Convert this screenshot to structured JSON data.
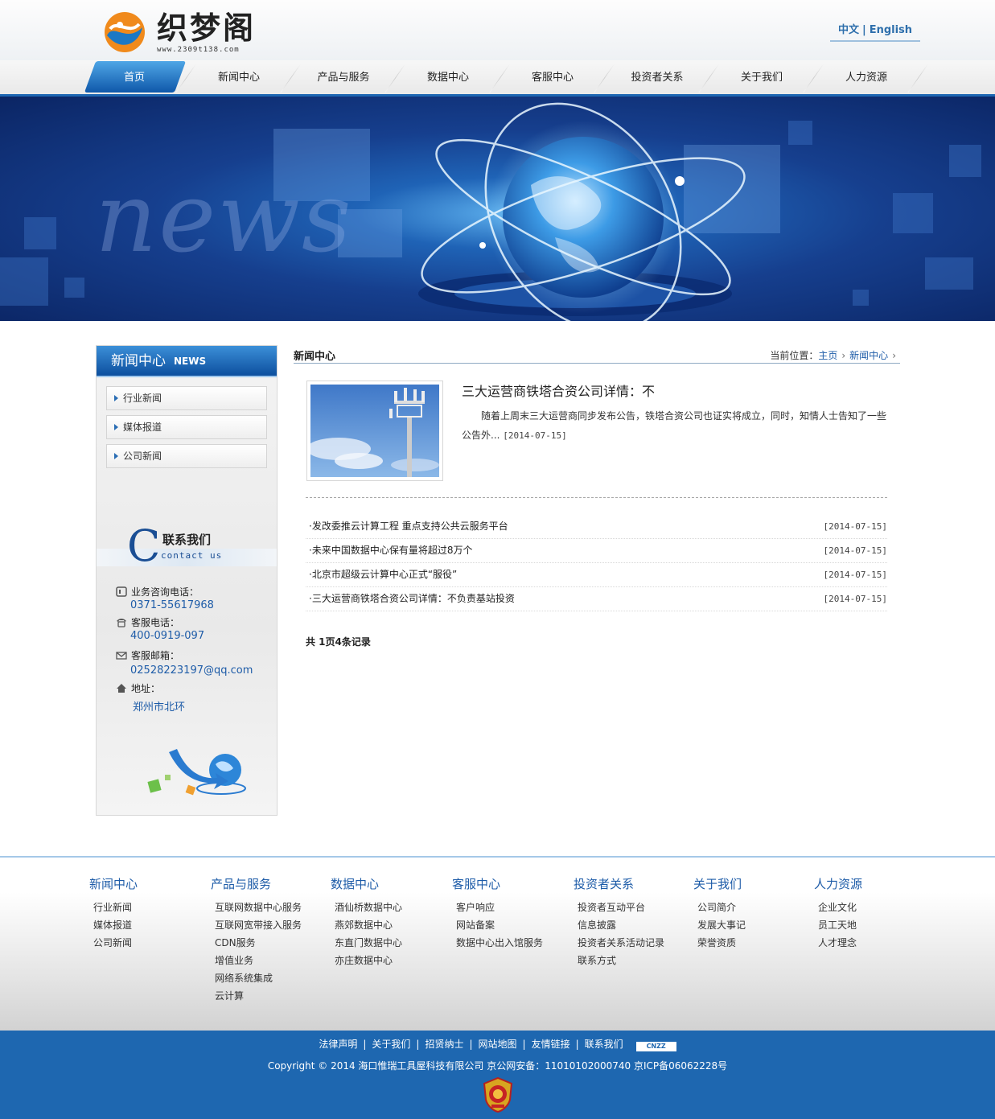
{
  "header": {
    "logo_text": "织梦阁",
    "logo_url": "www.2309t138.com",
    "lang_cn": "中文",
    "lang_en": "English"
  },
  "nav": {
    "items": [
      {
        "label": "首页",
        "active": true
      },
      {
        "label": "新闻中心"
      },
      {
        "label": "产品与服务"
      },
      {
        "label": "数据中心"
      },
      {
        "label": "客服中心"
      },
      {
        "label": "投资者关系"
      },
      {
        "label": "关于我们"
      },
      {
        "label": "人力资源"
      }
    ]
  },
  "banner": {
    "word": "news"
  },
  "sidebar": {
    "title_cn": "新闻中心",
    "title_en": "NEWS",
    "menu": [
      "行业新闻",
      "媒体报道",
      "公司新闻"
    ],
    "contact_cn": "联系我们",
    "contact_en": "contact us",
    "phone_label": "业务咨询电话：",
    "phone_value": "0371-55617968",
    "service_label": "客服电话：",
    "service_value": "400-0919-097",
    "email_label": "客服邮箱：",
    "email_value": "02528223197@qq.com",
    "addr_label": "地址：",
    "addr_value": "郑州市北环"
  },
  "main": {
    "title": "新闻中心",
    "crumb_label": "当前位置：",
    "crumb_home": "主页",
    "crumb_current": "新闻中心",
    "feature": {
      "title": "三大运营商铁塔合资公司详情：不",
      "desc": "随着上周末三大运营商同步发布公告，铁塔合资公司也证实将成立，同时，知情人士告知了一些公告外...",
      "date": "[2014-07-15]"
    },
    "list": [
      {
        "title": "·发改委推云计算工程 重点支持公共云服务平台",
        "date": "[2014-07-15]"
      },
      {
        "title": "·未来中国数据中心保有量将超过8万个",
        "date": "[2014-07-15]"
      },
      {
        "title": "·北京市超级云计算中心正式“服役”",
        "date": "[2014-07-15]"
      },
      {
        "title": "·三大运营商铁塔合资公司详情：不负责基站投资",
        "date": "[2014-07-15]"
      }
    ],
    "pager": "共 1页4条记录"
  },
  "footer_nav": [
    {
      "heading": "新闻中心",
      "items": [
        "行业新闻",
        "媒体报道",
        "公司新闻"
      ]
    },
    {
      "heading": "产品与服务",
      "items": [
        "互联网数据中心服务",
        "互联网宽带接入服务",
        "CDN服务",
        "增值业务",
        "网络系统集成",
        "云计算"
      ]
    },
    {
      "heading": "数据中心",
      "items": [
        "酒仙桥数据中心",
        "燕郊数据中心",
        "东直门数据中心",
        "亦庄数据中心"
      ]
    },
    {
      "heading": "客服中心",
      "items": [
        "客户响应",
        "网站备案",
        "数据中心出入馆服务"
      ]
    },
    {
      "heading": "投资者关系",
      "items": [
        "投资者互动平台",
        "信息披露",
        "投资者关系活动记录",
        "联系方式"
      ]
    },
    {
      "heading": "关于我们",
      "items": [
        "公司简介",
        "发展大事记",
        "荣誉资质"
      ]
    },
    {
      "heading": "人力资源",
      "items": [
        "企业文化",
        "员工天地",
        "人才理念"
      ]
    }
  ],
  "bottom": {
    "links": [
      "法律声明",
      "关于我们",
      "招贤纳士",
      "网站地图",
      "友情链接",
      "联系我们"
    ],
    "cnzz": "CNZZ",
    "copyright": "Copyright © 2014 海口惟瑞工具屋科技有限公司 京公网安备：11010102000740 京ICP备06062228号"
  },
  "colors": {
    "brand_blue": "#1e67b0",
    "link_blue": "#1e5ca8"
  }
}
